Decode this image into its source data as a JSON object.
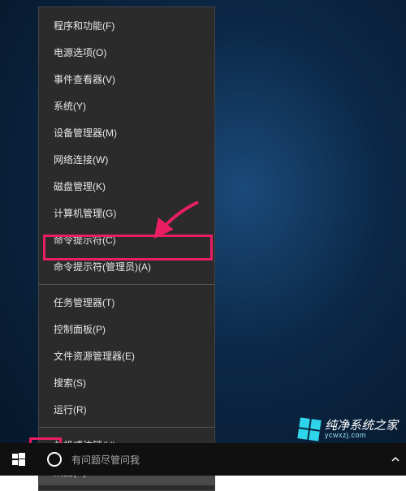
{
  "menu": {
    "groups": [
      {
        "items": [
          {
            "label": "程序和功能(F)",
            "key": "programs-features"
          },
          {
            "label": "电源选项(O)",
            "key": "power-options"
          },
          {
            "label": "事件查看器(V)",
            "key": "event-viewer"
          },
          {
            "label": "系统(Y)",
            "key": "system"
          },
          {
            "label": "设备管理器(M)",
            "key": "device-manager"
          },
          {
            "label": "网络连接(W)",
            "key": "network-connections"
          },
          {
            "label": "磁盘管理(K)",
            "key": "disk-management"
          },
          {
            "label": "计算机管理(G)",
            "key": "computer-management"
          },
          {
            "label": "命令提示符(C)",
            "key": "command-prompt"
          },
          {
            "label": "命令提示符(管理员)(A)",
            "key": "command-prompt-admin",
            "highlighted": true
          }
        ]
      },
      {
        "items": [
          {
            "label": "任务管理器(T)",
            "key": "task-manager"
          },
          {
            "label": "控制面板(P)",
            "key": "control-panel"
          },
          {
            "label": "文件资源管理器(E)",
            "key": "file-explorer"
          },
          {
            "label": "搜索(S)",
            "key": "search"
          },
          {
            "label": "运行(R)",
            "key": "run"
          }
        ]
      },
      {
        "items": [
          {
            "label": "关机或注销(U)",
            "key": "shutdown-signout",
            "submenu": true
          },
          {
            "label": "桌面(D)",
            "key": "desktop",
            "selected": true
          }
        ]
      }
    ]
  },
  "search": {
    "placeholder": "有问题尽管问我"
  },
  "watermark": {
    "main": "纯净系统之家",
    "sub": "ycwxzj.com"
  }
}
